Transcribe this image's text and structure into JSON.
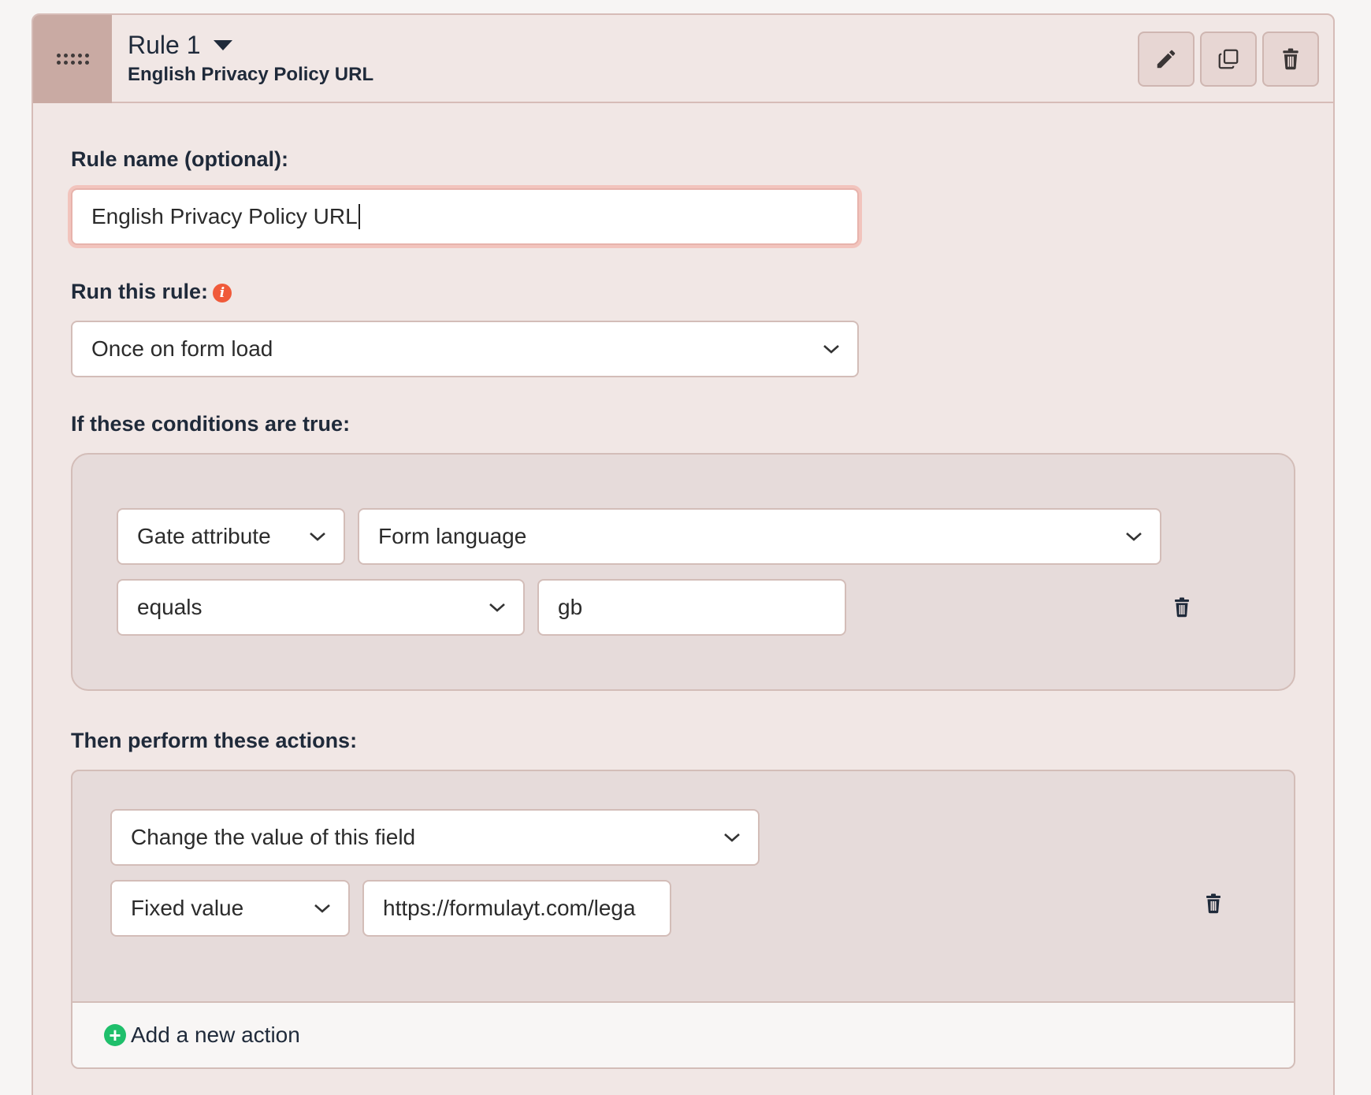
{
  "header": {
    "rule_title": "Rule 1",
    "rule_subtitle": "English Privacy Policy URL",
    "buttons": {
      "edit": "pencil-icon",
      "duplicate": "copy-icon",
      "delete": "trash-icon"
    }
  },
  "rule_name": {
    "label": "Rule name (optional):",
    "value": "English Privacy Policy URL"
  },
  "run_rule": {
    "label": "Run this rule:",
    "selected": "Once on form load"
  },
  "conditions": {
    "label": "If these conditions are true:",
    "items": [
      {
        "source": "Gate attribute",
        "attribute": "Form language",
        "operator": "equals",
        "value": "gb"
      }
    ]
  },
  "actions": {
    "label": "Then perform these actions:",
    "items": [
      {
        "action": "Change the value of this field",
        "value_type": "Fixed value",
        "value": "https://formulayt.com/lega"
      }
    ],
    "add_label": "Add a new action"
  },
  "colors": {
    "accent": "#f05a3a",
    "add": "#1fbf6b",
    "handle": "#c9aaa3"
  }
}
